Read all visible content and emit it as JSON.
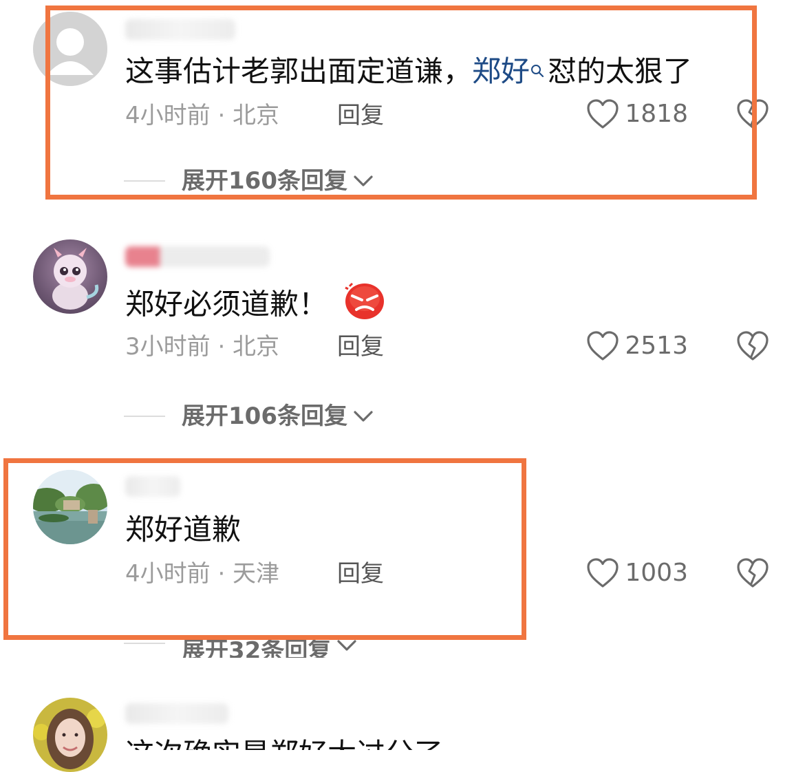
{
  "comments": [
    {
      "username": "",
      "text_before": "这事估计老郭出面定道谦，",
      "link_text": "郑好",
      "text_after": "怼的太狠了",
      "meta": "4小时前 · 北京",
      "reply_label": "回复",
      "likes": "1818",
      "expand_label": "展开160条回复"
    },
    {
      "username": "",
      "text": "郑好必须道歉！",
      "emoji": "angry-face-emoji",
      "meta": "3小时前 · 北京",
      "reply_label": "回复",
      "likes": "2513",
      "expand_label": "展开106条回复"
    },
    {
      "username": "",
      "text": "郑好道歉",
      "meta": "4小时前 · 天津",
      "reply_label": "回复",
      "likes": "1003",
      "expand_label": "展开32条回复"
    },
    {
      "username": "",
      "text": "这次确实是郑好太过分了",
      "meta": "",
      "reply_label": "",
      "likes": ""
    }
  ],
  "icons": {
    "like": "heart-outline-icon",
    "dislike": "broken-heart-icon",
    "expand": "chevron-down-icon",
    "search": "search-icon"
  },
  "colors": {
    "highlight": "#f07540",
    "link": "#1e4b86",
    "meta": "#9b9b9b"
  }
}
